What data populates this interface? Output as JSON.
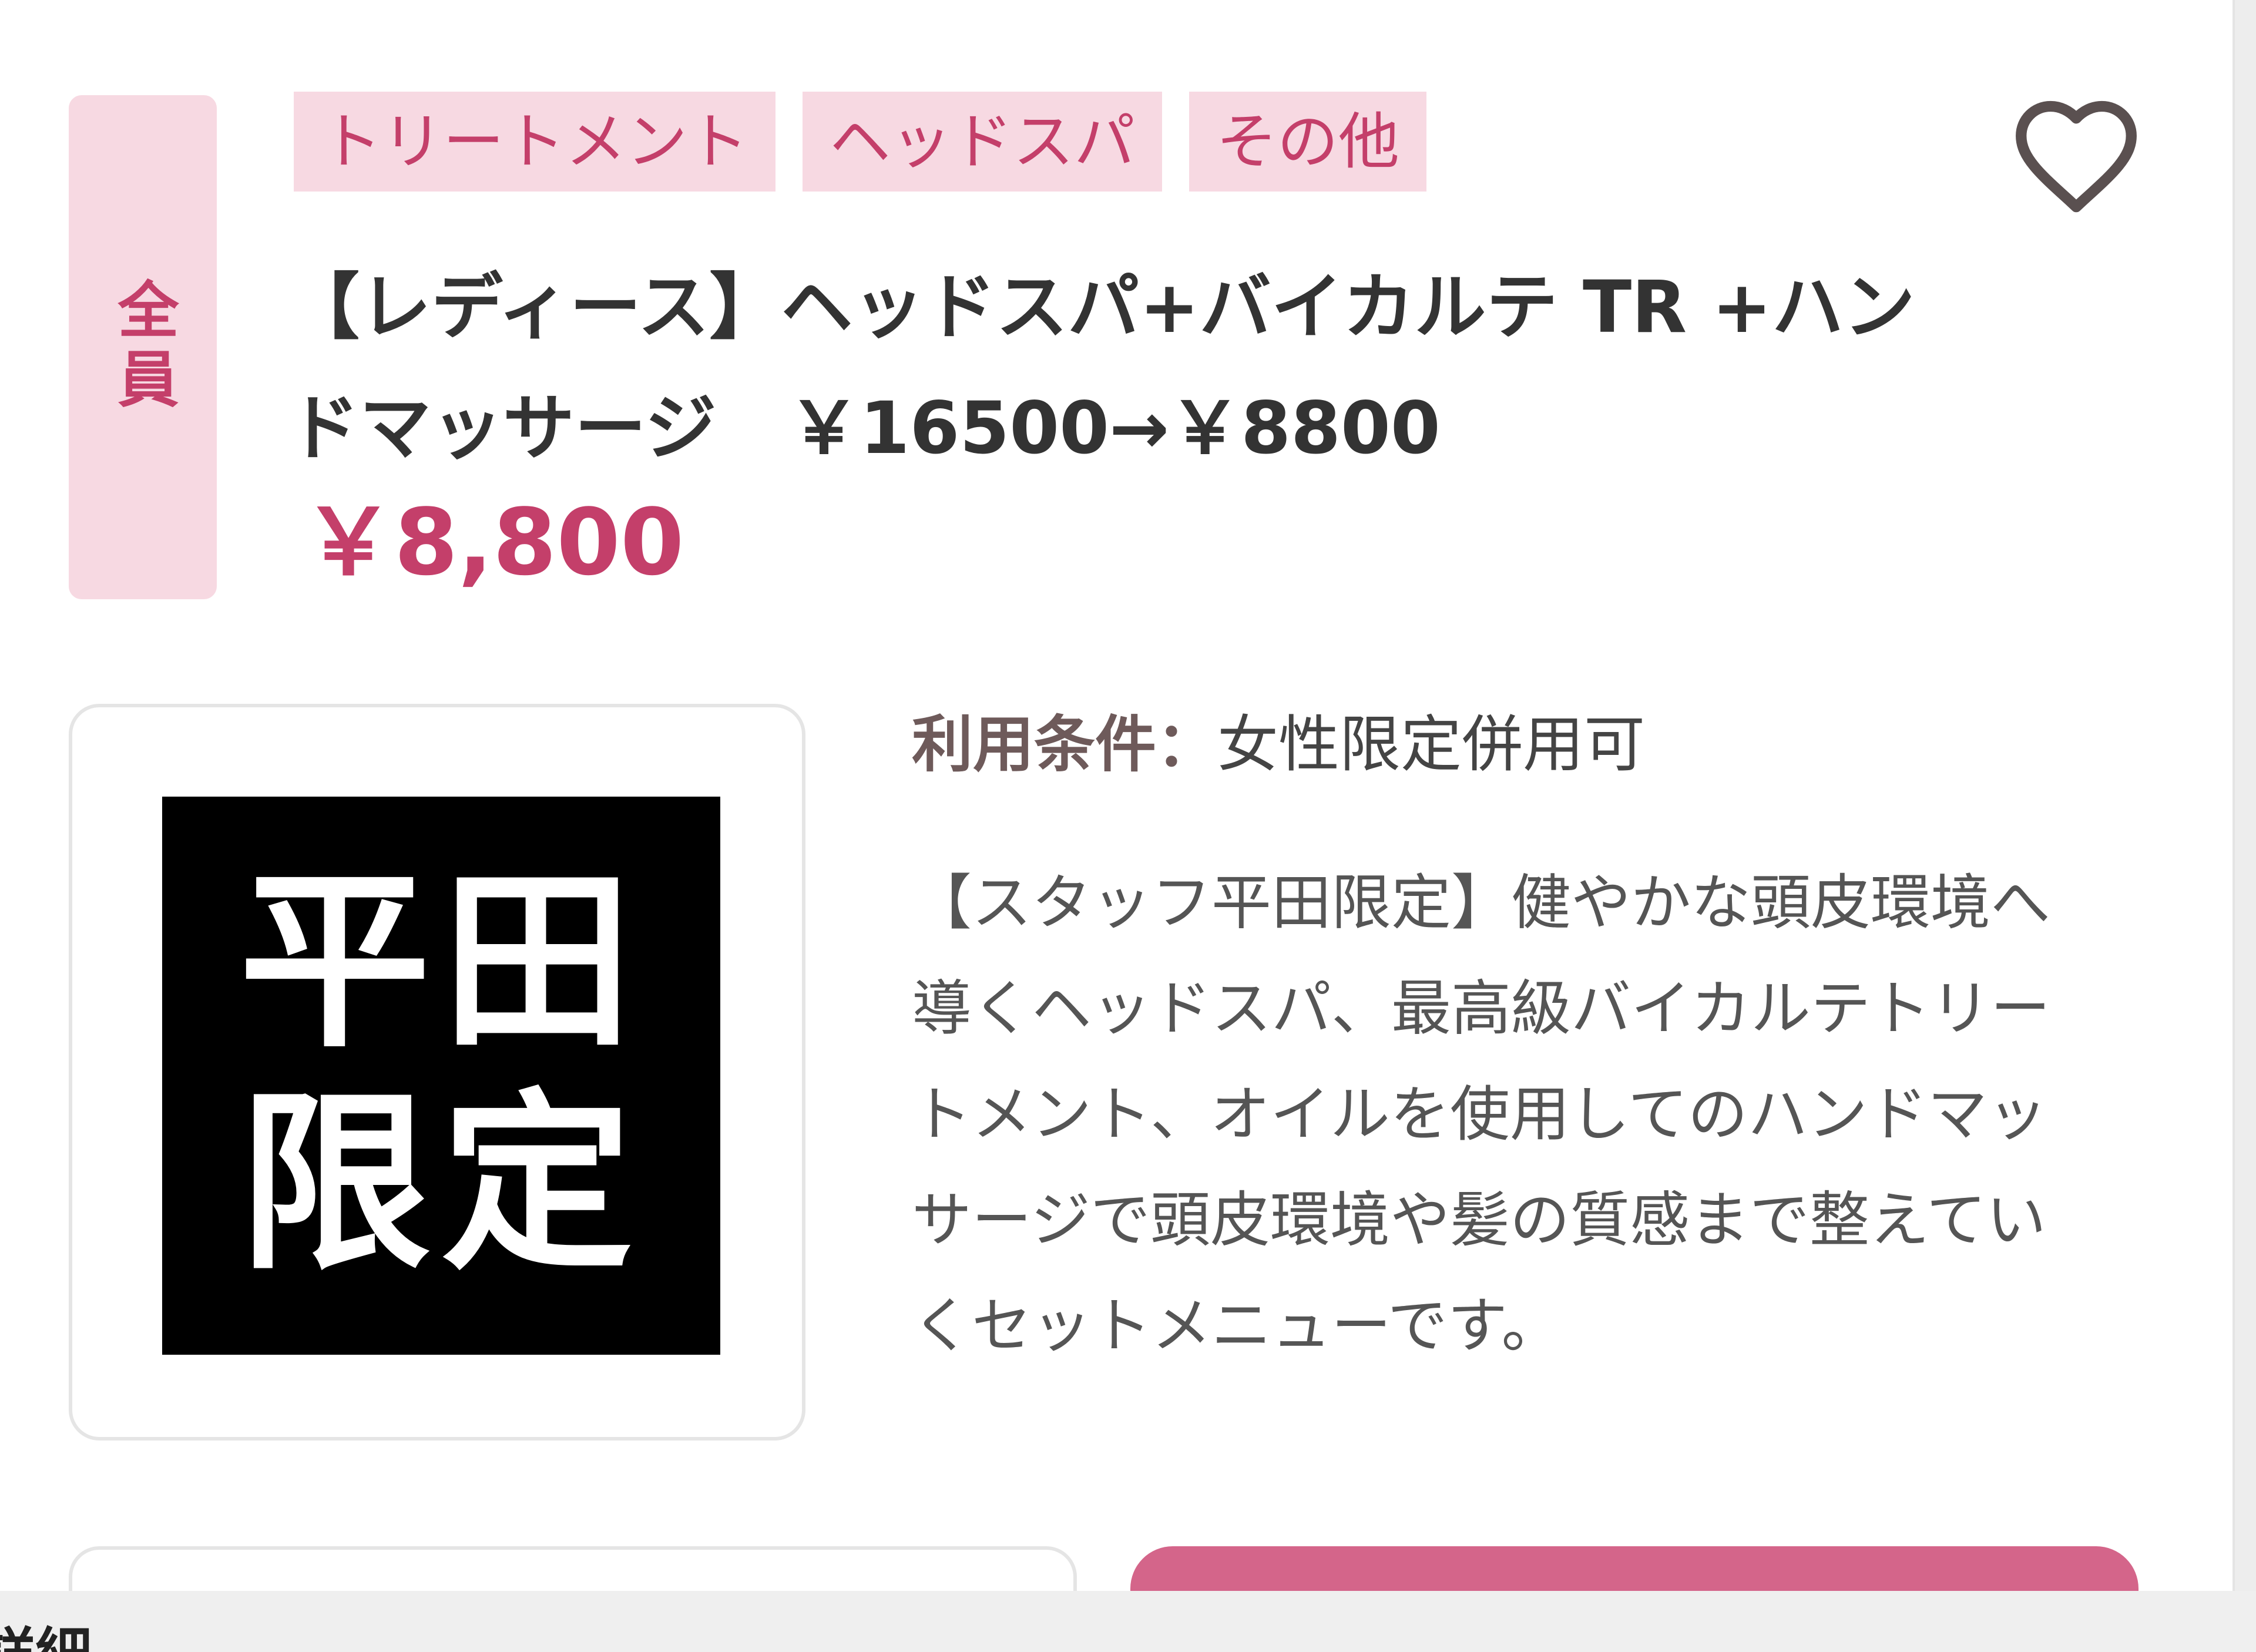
{
  "badge": {
    "label": "全員"
  },
  "tags": [
    "トリートメント",
    "ヘッドスパ",
    "その他"
  ],
  "favorite": {
    "icon": "heart-icon"
  },
  "coupon": {
    "title": "【レディース】ヘッドスパ+バイカルテ TR +ハンドマッサージ　￥16500→￥8800",
    "price": "￥8,800",
    "thumbnail_lines": [
      "平田",
      "限定"
    ],
    "conditions_label": "利用条件：",
    "conditions_value": "女性限定併用可",
    "description": "【スタッフ平田限定】健やかな頭皮環境へ導くヘッドスパ、最高級バイカルテトリートメント、オイルを使用してのハンドマッサージで頭皮環境や髪の質感まで整えていくセットメニューです。"
  },
  "bottom_bar": {
    "text": "詳細"
  },
  "colors": {
    "accent": "#c43f6a",
    "tag_bg": "#f7d9e2",
    "primary_button": "#d4658a"
  }
}
